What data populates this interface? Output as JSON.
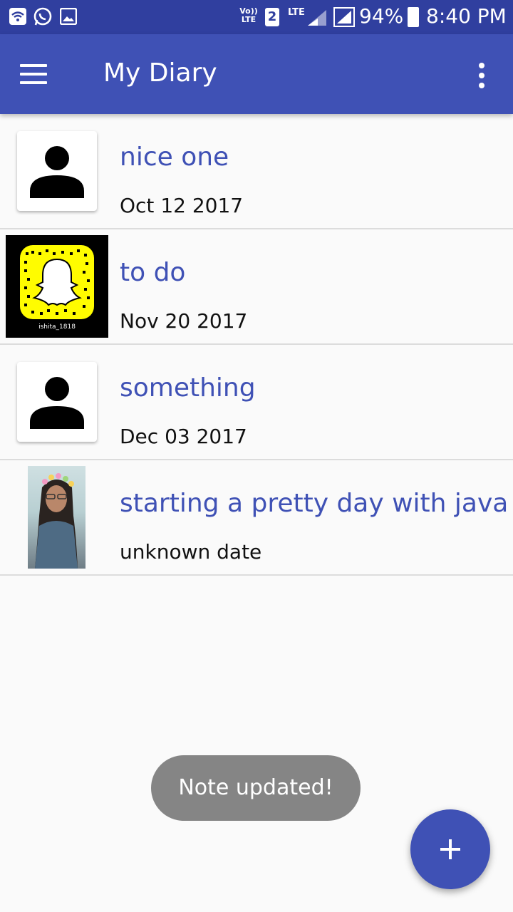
{
  "status_bar": {
    "left_icons": [
      "wifi-icon",
      "whatsapp-icon",
      "gallery-icon"
    ],
    "volte_label": "Vo))\nLTE",
    "sim_label": "2",
    "lte_label": "LTE",
    "battery_percent": "94%",
    "time": "8:40 PM"
  },
  "app_bar": {
    "title": "My Diary",
    "nav_icon": "menu-icon",
    "overflow_icon": "more-vert-icon",
    "color": "#3f51b5"
  },
  "notes": [
    {
      "title": "nice one",
      "date": "Oct 12 2017",
      "thumbnail": "person-placeholder-icon"
    },
    {
      "title": "to do",
      "date": "Nov 20 2017",
      "thumbnail": "snapcode-image",
      "thumbnail_caption": "ishita_1818"
    },
    {
      "title": "something",
      "date": "Dec 03 2017",
      "thumbnail": "person-placeholder-icon"
    },
    {
      "title": "starting a pretty day with java",
      "date": "unknown date",
      "thumbnail": "selfie-photo"
    }
  ],
  "toast": {
    "text": "Note updated!"
  },
  "fab": {
    "icon": "add-icon",
    "color": "#3f51b5"
  }
}
